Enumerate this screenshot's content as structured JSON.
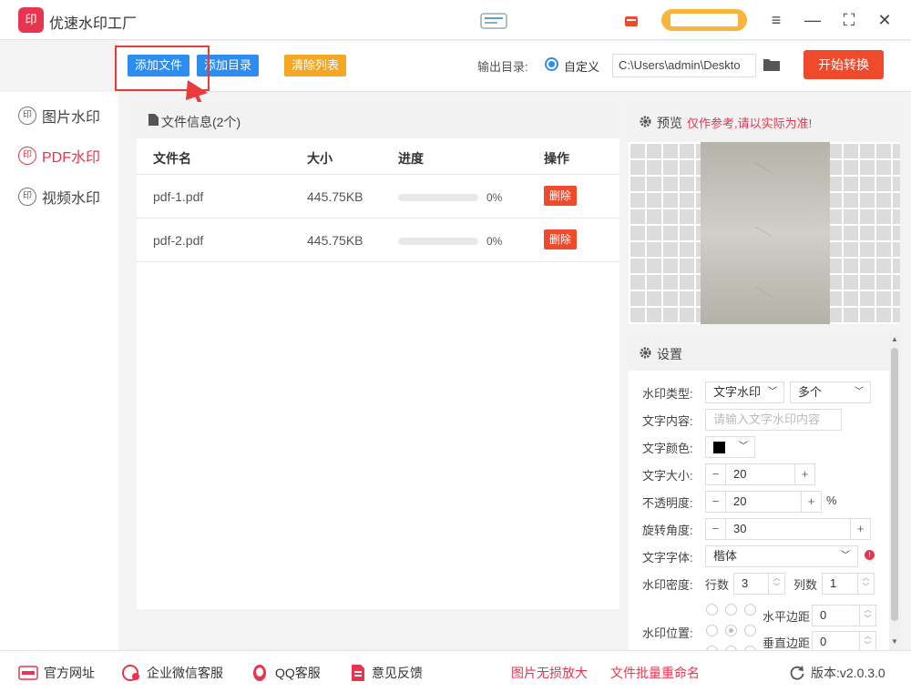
{
  "app": {
    "logo_text": "印",
    "title": "优速水印工厂"
  },
  "window_controls": {
    "menu": "≡",
    "minimize": "—",
    "maximize": "⛶",
    "close": "✕"
  },
  "toolbar": {
    "add_file": "添加文件",
    "add_folder": "添加目录",
    "clear_list": "清除列表",
    "output_label": "输出目录:",
    "custom_option": "自定义",
    "output_path": "C:\\Users\\admin\\Deskto",
    "start": "开始转换"
  },
  "sidebar": {
    "items": [
      {
        "icon_text": "印",
        "label": "图片水印",
        "active": false
      },
      {
        "icon_text": "印",
        "label": "PDF水印",
        "active": true
      },
      {
        "icon_text": "印",
        "label": "视频水印",
        "active": false
      }
    ]
  },
  "file_panel": {
    "header": "文件信息(2个)",
    "columns": [
      "文件名",
      "大小",
      "进度",
      "操作"
    ],
    "rows": [
      {
        "name": "pdf-1.pdf",
        "size": "445.75KB",
        "progress": 0,
        "progress_text": "0%",
        "action": "删除"
      },
      {
        "name": "pdf-2.pdf",
        "size": "445.75KB",
        "progress": 0,
        "progress_text": "0%",
        "action": "删除"
      }
    ]
  },
  "preview": {
    "title": "预览",
    "note": "仅作参考,请以实际为准!"
  },
  "settings": {
    "title": "设置",
    "type_label": "水印类型:",
    "type_value": "文字水印",
    "count_value": "多个",
    "content_label": "文字内容:",
    "content_placeholder": "请输入文字水印内容",
    "color_label": "文字颜色:",
    "color_value": "#000000",
    "size_label": "文字大小:",
    "size_value": "20",
    "opacity_label": "不透明度:",
    "opacity_value": "20",
    "opacity_unit": "%",
    "rotate_label": "旋转角度:",
    "rotate_value": "30",
    "font_label": "文字字体:",
    "font_value": "楷体",
    "density_label": "水印密度:",
    "rows_label": "行数",
    "rows_value": "3",
    "cols_label": "列数",
    "cols_value": "1",
    "position_label": "水印位置:",
    "hmargin_label": "水平边距",
    "hmargin_value": "0",
    "vmargin_label": "垂直边距",
    "vmargin_value": "0",
    "minus": "−",
    "plus": "+"
  },
  "footer": {
    "website": "官方网址",
    "wechat": "企业微信客服",
    "qq": "QQ客服",
    "feedback": "意见反馈",
    "lossless": "图片无损放大",
    "rename": "文件批量重命名",
    "version": "版本:v2.0.3.0"
  },
  "colors": {
    "accent": "#e8344e",
    "blue": "#2d8cf0",
    "orange": "#f5a623",
    "red": "#f04a2c"
  }
}
